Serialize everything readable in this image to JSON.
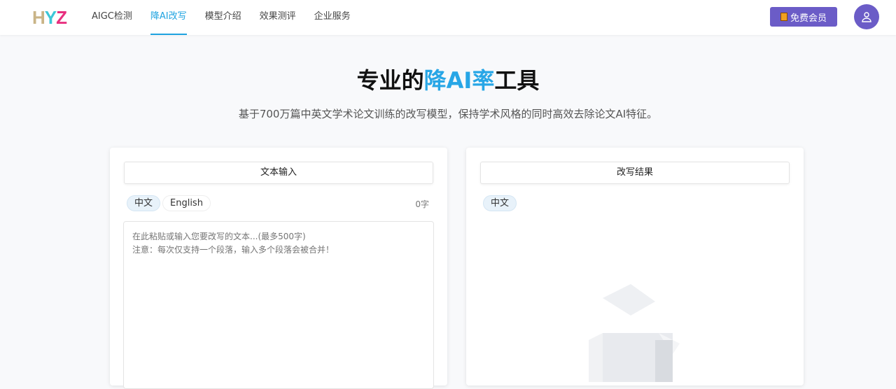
{
  "nav": {
    "logo": "HYZ",
    "items": [
      "AIGC检测",
      "降AI改写",
      "模型介绍",
      "效果测评",
      "企业服务"
    ],
    "vip": "免费会员"
  },
  "hero": {
    "title_pre": "专业的",
    "title_hl": "降AI率",
    "title_post": "工具",
    "subtitle": "基于700万篇中英文学术论文训练的改写模型，保持学术风格的同时高效去除论文AI特征。"
  },
  "input": {
    "header": "文本输入",
    "lang_zh": "中文",
    "lang_en": "English",
    "count": "0字",
    "placeholder": "在此粘贴或输入您要改写的文本...(最多500字)\n注意：每次仅支持一个段落，输入多个段落会被合并！"
  },
  "output": {
    "header": "改写结果",
    "lang_zh": "中文"
  }
}
